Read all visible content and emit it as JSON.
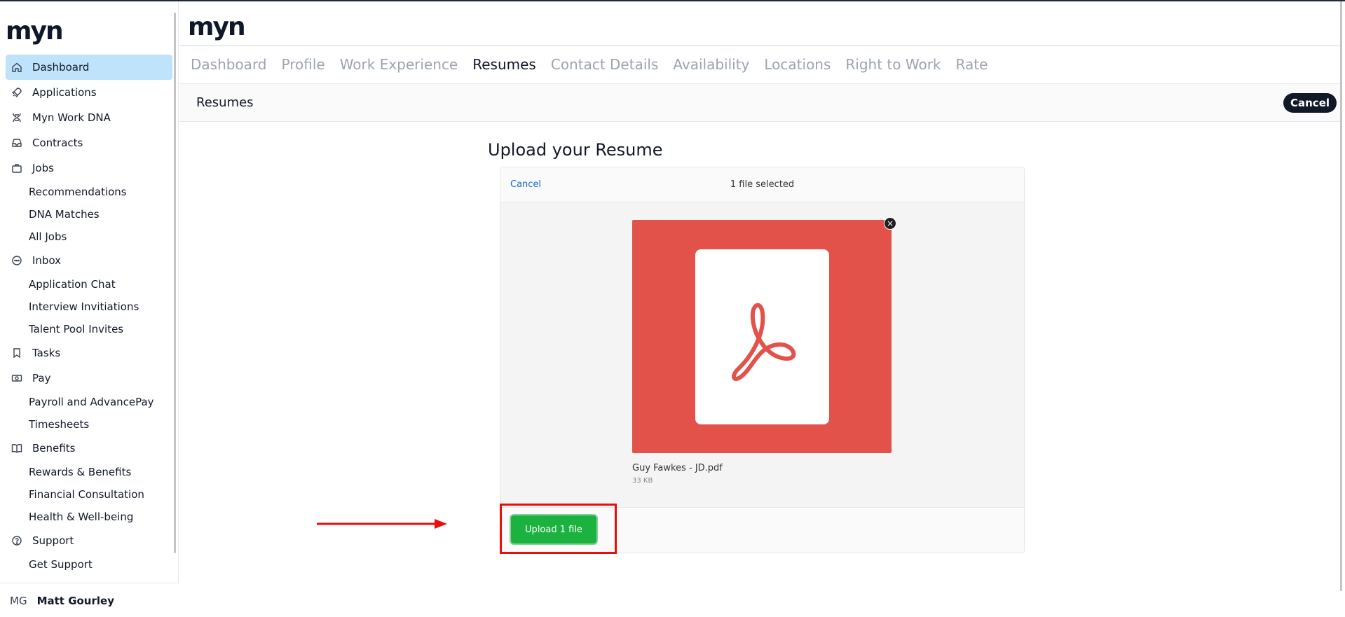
{
  "sidebar": {
    "logo": "myn",
    "items": [
      {
        "type": "main",
        "label": "Dashboard",
        "icon": "home-icon",
        "active": true
      },
      {
        "type": "main",
        "label": "Applications",
        "icon": "rocket-icon"
      },
      {
        "type": "main",
        "label": "Myn Work DNA",
        "icon": "dna-icon"
      },
      {
        "type": "main",
        "label": "Contracts",
        "icon": "inbox-tray-icon"
      },
      {
        "type": "main",
        "label": "Jobs",
        "icon": "briefcase-icon"
      },
      {
        "type": "sub",
        "label": "Recommendations"
      },
      {
        "type": "sub",
        "label": "DNA Matches"
      },
      {
        "type": "sub",
        "label": "All Jobs"
      },
      {
        "type": "main",
        "label": "Inbox",
        "icon": "chat-icon"
      },
      {
        "type": "sub",
        "label": "Application Chat"
      },
      {
        "type": "sub",
        "label": "Interview Invitiations"
      },
      {
        "type": "sub",
        "label": "Talent Pool Invites"
      },
      {
        "type": "main",
        "label": "Tasks",
        "icon": "bookmark-icon"
      },
      {
        "type": "main",
        "label": "Pay",
        "icon": "money-icon"
      },
      {
        "type": "sub",
        "label": "Payroll and AdvancePay"
      },
      {
        "type": "sub",
        "label": "Timesheets"
      },
      {
        "type": "main",
        "label": "Benefits",
        "icon": "book-icon"
      },
      {
        "type": "sub",
        "label": "Rewards & Benefits"
      },
      {
        "type": "sub",
        "label": "Financial Consultation"
      },
      {
        "type": "sub",
        "label": "Health & Well-being"
      },
      {
        "type": "main",
        "label": "Support",
        "icon": "help-circle-icon"
      },
      {
        "type": "sub",
        "label": "Get Support"
      }
    ],
    "user": {
      "initials": "MG",
      "name": "Matt Gourley"
    }
  },
  "header": {
    "logo": "myn",
    "tabs": [
      {
        "label": "Dashboard",
        "active": false
      },
      {
        "label": "Profile",
        "active": false
      },
      {
        "label": "Work Experience",
        "active": false
      },
      {
        "label": "Resumes",
        "active": true
      },
      {
        "label": "Contact Details",
        "active": false
      },
      {
        "label": "Availability",
        "active": false
      },
      {
        "label": "Locations",
        "active": false
      },
      {
        "label": "Right to Work",
        "active": false
      },
      {
        "label": "Rate",
        "active": false
      }
    ]
  },
  "section": {
    "title": "Resumes",
    "cancel_label": "Cancel"
  },
  "uploader": {
    "heading": "Upload your Resume",
    "cancel_label": "Cancel",
    "status": "1 file selected",
    "remove_label": "×",
    "file": {
      "name": "Guy Fawkes - JD.pdf",
      "size": "33 KB",
      "icon": "pdf-file-icon",
      "color": "#e2524a"
    },
    "upload_label": "Upload 1 file",
    "upload_color": "#1bb240"
  },
  "annotation": {
    "highlight_color": "#ee0b0b"
  }
}
